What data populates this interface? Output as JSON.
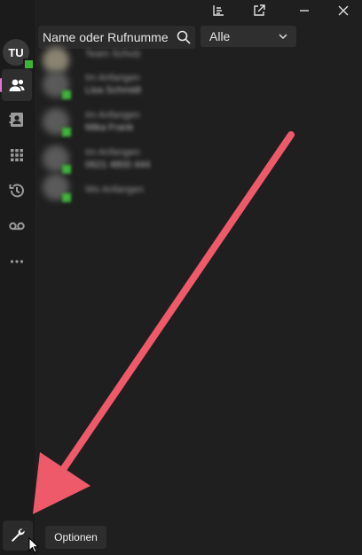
{
  "avatar": {
    "initials": "TU",
    "presence_color": "#3fb23a"
  },
  "nav": {
    "items": [
      {
        "icon": "contacts-icon",
        "active": true
      },
      {
        "icon": "address-book-icon"
      },
      {
        "icon": "dialpad-icon"
      },
      {
        "icon": "history-icon"
      },
      {
        "icon": "voicemail-icon"
      },
      {
        "icon": "more-icon"
      }
    ],
    "settings_icon": "wrench-icon"
  },
  "titlebar": {
    "icons": [
      "chart-icon",
      "external-link-icon",
      "minimize-icon",
      "close-icon"
    ]
  },
  "search": {
    "placeholder": "Name oder Rufnumme"
  },
  "filter": {
    "selected": "Alle"
  },
  "contacts": [
    {
      "line1": "Team Schulz",
      "line2": ""
    },
    {
      "line1": "Im Anfangen",
      "line2": "Lisa Schmidt"
    },
    {
      "line1": "Im Anfangen",
      "line2": "Mika Frank"
    },
    {
      "line1": "Im Anfangen",
      "line2": "0621 4800 444"
    },
    {
      "line1": "Wo Anfangen",
      "line2": ""
    }
  ],
  "tooltip": {
    "text": "Optionen"
  },
  "colors": {
    "accent_pink": "#e576d8",
    "arrow": "#ef5a6b",
    "status_green": "#3fb23a"
  }
}
